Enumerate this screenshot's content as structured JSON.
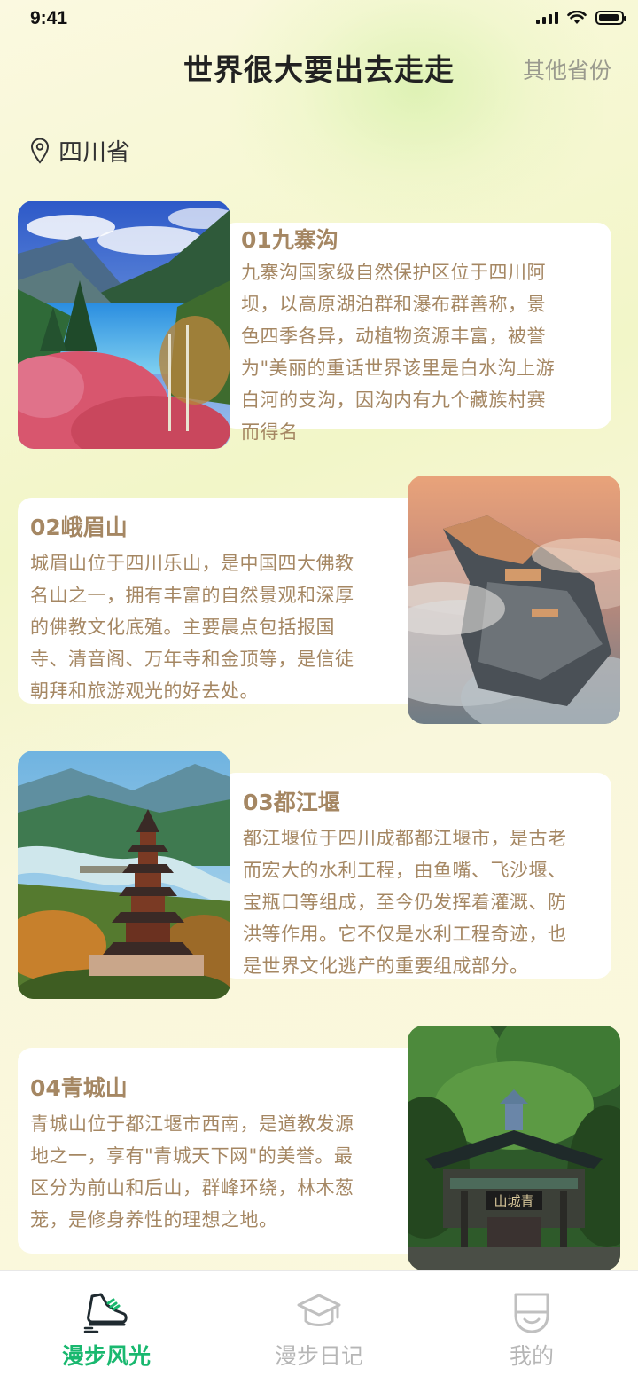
{
  "status_bar": {
    "time": "9:41"
  },
  "header": {
    "title": "世界很大要出去走走",
    "other_provinces": "其他省份"
  },
  "location": {
    "province": "四川省",
    "icon": "location-pin-icon"
  },
  "spots": [
    {
      "title": "01九寨沟",
      "lines": [
        "九寨沟国家级自然保护区位于四川阿",
        "坝，以高原湖泊群和瀑布群善称，景",
        "色四季各异，动植物资源丰富，被誉",
        "为\"美丽的重话世界该里是白水沟上游",
        "白河的支沟，因沟内有九个藏族村赛",
        "而得名"
      ]
    },
    {
      "title": "02峨眉山",
      "lines": [
        "城眉山位于四川乐山，是中国四大佛教",
        "名山之一，拥有丰富的自然景观和深厚",
        "的佛教文化底殖。主要晨点包括报国",
        "寺、清音阁、万年寺和金顶等，是信徒",
        "朝拜和旅游观光的好去处。"
      ]
    },
    {
      "title": "03都江堰",
      "lines": [
        "都江堰位于四川成都都江堰市，是古老",
        "而宏大的水利工程，由鱼嘴、飞沙堰、",
        "宝瓶口等组成，至今仍发挥着灌溉、防",
        "洪等作用。它不仅是水利工程奇迹，也",
        "是世界文化逃产的重要组成部分。"
      ]
    },
    {
      "title": "04青城山",
      "lines": [
        "青城山位于都江堰市西南，是道教发源",
        "地之一，享有\"青城天下网\"的美誉。最",
        "区分为前山和后山，群峰环绕，林木葱",
        "茏，是修身养性的理想之地。"
      ],
      "gate_plaque": "山城青"
    }
  ],
  "tabs": [
    {
      "label": "漫步风光",
      "icon": "sneaker-icon",
      "active": true
    },
    {
      "label": "漫步日记",
      "icon": "graduation-cap-icon",
      "active": false
    },
    {
      "label": "我的",
      "icon": "profile-face-icon",
      "active": false
    }
  ],
  "colors": {
    "accent": "#19b86f",
    "card_text": "#a58763",
    "tab_inactive": "#b6b6b6"
  }
}
